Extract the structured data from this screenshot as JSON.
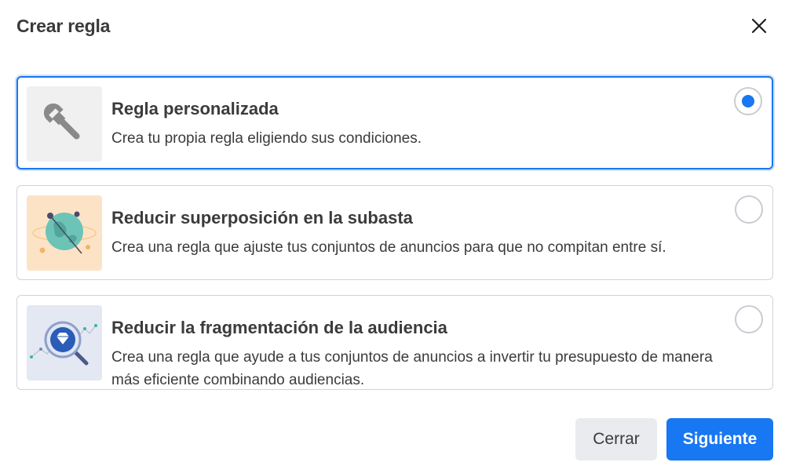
{
  "dialog": {
    "title": "Crear regla",
    "close_icon": "close-icon"
  },
  "options": [
    {
      "title": "Regla personalizada",
      "description": "Crea tu propia regla eligiendo sus condiciones.",
      "icon": "wrench-icon",
      "selected": true
    },
    {
      "title": "Reducir superposición en la subasta",
      "description": "Crea una regla que ajuste tus conjuntos de anuncios para que no compitan entre sí.",
      "icon": "globe-orbit-icon",
      "selected": false
    },
    {
      "title": "Reducir la fragmentación de la audiencia",
      "description": "Crea una regla que ayude a tus conjuntos de anuncios a invertir tu presupuesto de manera más eficiente combinando audiencias.",
      "icon": "magnifier-diamond-icon",
      "selected": false
    }
  ],
  "footer": {
    "cancel_label": "Cerrar",
    "next_label": "Siguiente"
  },
  "colors": {
    "accent": "#1877f2",
    "selected_ring": "#cfe1fb",
    "border": "#d0d3d8",
    "text": "#3a3b3c"
  }
}
